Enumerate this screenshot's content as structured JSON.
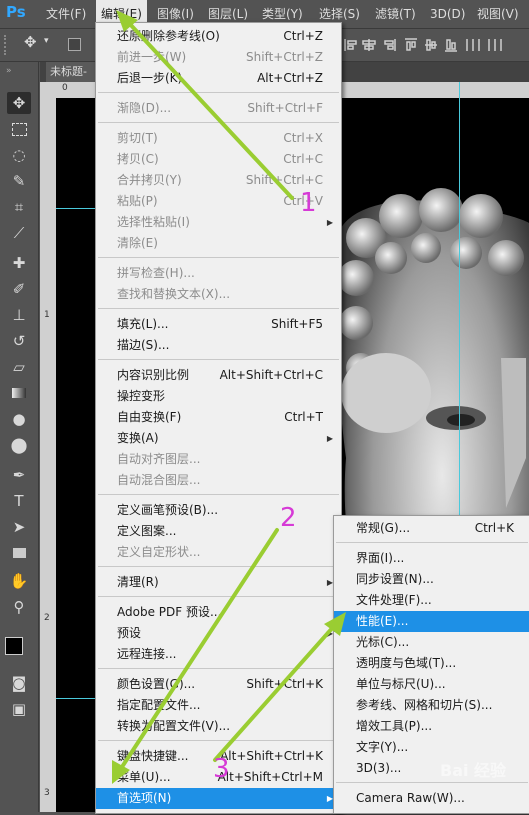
{
  "app": {
    "logo": "Ps"
  },
  "menubar": {
    "items": [
      "文件(F)",
      "编辑(E)",
      "图像(I)",
      "图层(L)",
      "类型(Y)",
      "选择(S)",
      "滤镜(T)",
      "3D(D)",
      "视图(V)"
    ]
  },
  "document": {
    "tab_label": "未标题-"
  },
  "ruler": {
    "top_ticks": [
      "0"
    ],
    "left_ticks": [
      "1",
      "2",
      "3"
    ]
  },
  "edit_menu": {
    "items": [
      {
        "label": "还原删除参考线(O)",
        "shortcut": "Ctrl+Z"
      },
      {
        "label": "前进一步(W)",
        "shortcut": "Shift+Ctrl+Z"
      },
      {
        "label": "后退一步(K)",
        "shortcut": "Alt+Ctrl+Z"
      },
      {
        "label": "渐隐(D)...",
        "shortcut": "Shift+Ctrl+F"
      },
      {
        "label": "剪切(T)",
        "shortcut": "Ctrl+X"
      },
      {
        "label": "拷贝(C)",
        "shortcut": "Ctrl+C"
      },
      {
        "label": "合并拷贝(Y)",
        "shortcut": "Shift+Ctrl+C"
      },
      {
        "label": "粘贴(P)",
        "shortcut": "Ctrl+V"
      },
      {
        "label": "选择性粘贴(I)",
        "shortcut": ""
      },
      {
        "label": "清除(E)",
        "shortcut": ""
      },
      {
        "label": "拼写检查(H)...",
        "shortcut": ""
      },
      {
        "label": "查找和替换文本(X)...",
        "shortcut": ""
      },
      {
        "label": "填充(L)...",
        "shortcut": "Shift+F5"
      },
      {
        "label": "描边(S)...",
        "shortcut": ""
      },
      {
        "label": "内容识别比例",
        "shortcut": "Alt+Shift+Ctrl+C"
      },
      {
        "label": "操控变形",
        "shortcut": ""
      },
      {
        "label": "自由变换(F)",
        "shortcut": "Ctrl+T"
      },
      {
        "label": "变换(A)",
        "shortcut": ""
      },
      {
        "label": "自动对齐图层...",
        "shortcut": ""
      },
      {
        "label": "自动混合图层...",
        "shortcut": ""
      },
      {
        "label": "定义画笔预设(B)...",
        "shortcut": ""
      },
      {
        "label": "定义图案...",
        "shortcut": ""
      },
      {
        "label": "定义自定形状...",
        "shortcut": ""
      },
      {
        "label": "清理(R)",
        "shortcut": ""
      },
      {
        "label": "Adobe PDF 预设...",
        "shortcut": ""
      },
      {
        "label": "预设",
        "shortcut": ""
      },
      {
        "label": "远程连接...",
        "shortcut": ""
      },
      {
        "label": "颜色设置(G)...",
        "shortcut": "Shift+Ctrl+K"
      },
      {
        "label": "指定配置文件...",
        "shortcut": ""
      },
      {
        "label": "转换为配置文件(V)...",
        "shortcut": ""
      },
      {
        "label": "键盘快捷键...",
        "shortcut": "Alt+Shift+Ctrl+K"
      },
      {
        "label": "菜单(U)...",
        "shortcut": "Alt+Shift+Ctrl+M"
      },
      {
        "label": "首选项(N)",
        "shortcut": ""
      }
    ]
  },
  "preferences_submenu": {
    "items": [
      {
        "label": "常规(G)...",
        "shortcut": "Ctrl+K"
      },
      {
        "label": "界面(I)...",
        "shortcut": ""
      },
      {
        "label": "同步设置(N)...",
        "shortcut": ""
      },
      {
        "label": "文件处理(F)...",
        "shortcut": ""
      },
      {
        "label": "性能(E)...",
        "shortcut": ""
      },
      {
        "label": "光标(C)...",
        "shortcut": ""
      },
      {
        "label": "透明度与色域(T)...",
        "shortcut": ""
      },
      {
        "label": "单位与标尺(U)...",
        "shortcut": ""
      },
      {
        "label": "参考线、网格和切片(S)...",
        "shortcut": ""
      },
      {
        "label": "增效工具(P)...",
        "shortcut": ""
      },
      {
        "label": "文字(Y)...",
        "shortcut": ""
      },
      {
        "label": "3D(3)...",
        "shortcut": ""
      },
      {
        "label": "Camera Raw(W)...",
        "shortcut": ""
      }
    ]
  },
  "annotations": {
    "step1": "1",
    "step2": "2",
    "step3": "3",
    "color": "#d63ad6",
    "arrow_color": "#9acd32"
  },
  "watermark": "Bai 经验"
}
